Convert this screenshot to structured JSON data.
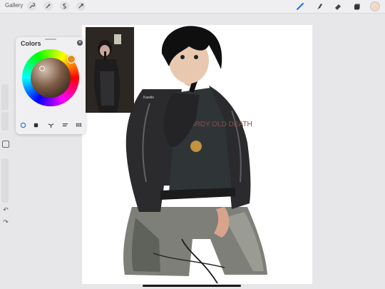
{
  "topbar": {
    "gallery_label": "Gallery",
    "left_tools": [
      "wrench-icon",
      "magic-wand-icon",
      "selection-icon",
      "transform-arrow-icon"
    ],
    "right_tools": [
      "brush-icon",
      "smudge-icon",
      "eraser-icon",
      "layers-icon"
    ],
    "current_color": "#f3d9c4",
    "active_tool_color": "#1f6fe0"
  },
  "sidebar": {
    "controls": [
      "brush-size-slider",
      "modify-button",
      "opacity-slider",
      "undo-button",
      "redo-button"
    ],
    "undo_glyph": "↶",
    "redo_glyph": "↷"
  },
  "colors_panel": {
    "title": "Colors",
    "close_glyph": "✕",
    "selected_hue": "#e58a1e",
    "selected_color": "#caa68e",
    "modes": [
      "disc-mode",
      "classic-mode",
      "harmony-mode",
      "value-mode",
      "palettes-mode"
    ],
    "active_mode": "disc-mode"
  },
  "canvas": {
    "background": "#ffffff",
    "shirt_text": "GIRDY OLD DEATH",
    "jacket_tag": "Kawtie"
  }
}
